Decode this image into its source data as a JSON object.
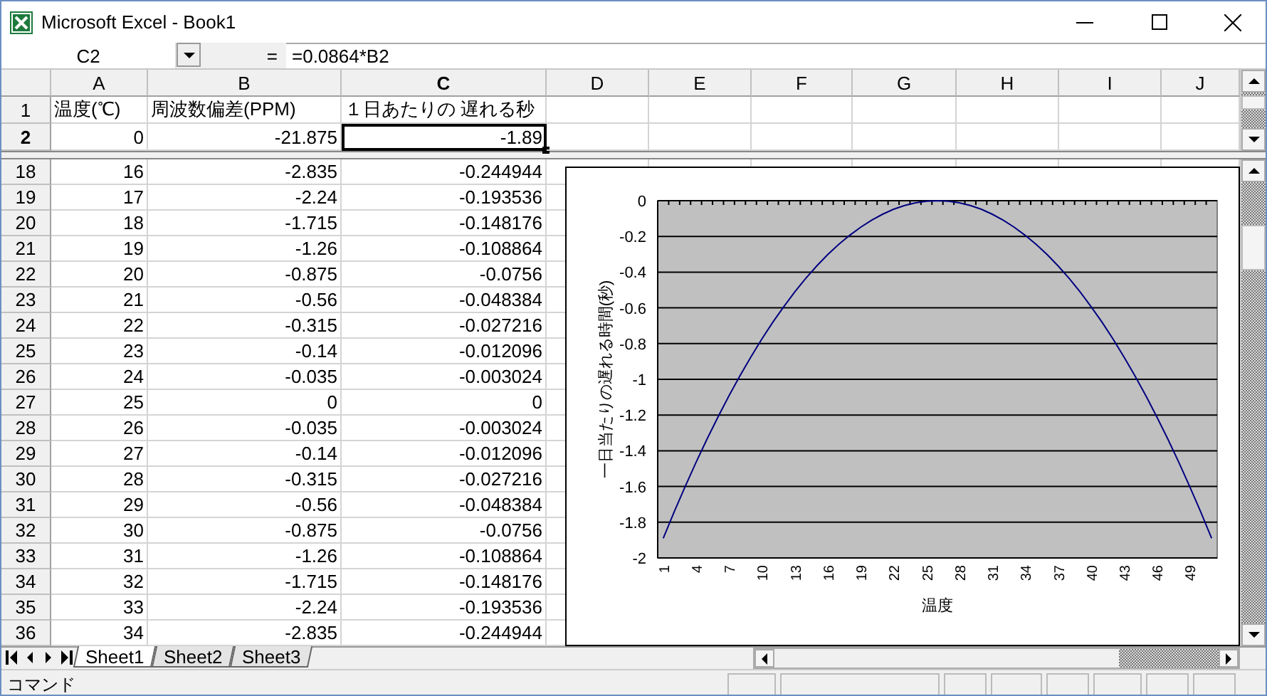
{
  "window": {
    "title": "Microsoft Excel - Book1"
  },
  "formula_bar": {
    "name_box": "C2",
    "equals": "=",
    "formula": "=0.0864*B2"
  },
  "columns": [
    {
      "label": "A",
      "selected": false
    },
    {
      "label": "B",
      "selected": false
    },
    {
      "label": "C",
      "selected": true
    },
    {
      "label": "D",
      "selected": false
    },
    {
      "label": "E",
      "selected": false
    },
    {
      "label": "F",
      "selected": false
    },
    {
      "label": "G",
      "selected": false
    },
    {
      "label": "H",
      "selected": false
    },
    {
      "label": "I",
      "selected": false
    },
    {
      "label": "J",
      "selected": false
    }
  ],
  "frozen_rows": [
    {
      "header": "1",
      "kind": "text",
      "selected": false,
      "cells": [
        "温度(℃)",
        "周波数偏差(PPM)",
        "１日あたりの 遅れる秒"
      ]
    },
    {
      "header": "2",
      "kind": "number",
      "selected": true,
      "cells": [
        "0",
        "-21.875",
        "-1.89"
      ]
    }
  ],
  "rows": [
    {
      "header": "18",
      "kind": "number",
      "selected": false,
      "cells": [
        "16",
        "-2.835",
        "-0.244944"
      ]
    },
    {
      "header": "19",
      "kind": "number",
      "selected": false,
      "cells": [
        "17",
        "-2.24",
        "-0.193536"
      ]
    },
    {
      "header": "20",
      "kind": "number",
      "selected": false,
      "cells": [
        "18",
        "-1.715",
        "-0.148176"
      ]
    },
    {
      "header": "21",
      "kind": "number",
      "selected": false,
      "cells": [
        "19",
        "-1.26",
        "-0.108864"
      ]
    },
    {
      "header": "22",
      "kind": "number",
      "selected": false,
      "cells": [
        "20",
        "-0.875",
        "-0.0756"
      ]
    },
    {
      "header": "23",
      "kind": "number",
      "selected": false,
      "cells": [
        "21",
        "-0.56",
        "-0.048384"
      ]
    },
    {
      "header": "24",
      "kind": "number",
      "selected": false,
      "cells": [
        "22",
        "-0.315",
        "-0.027216"
      ]
    },
    {
      "header": "25",
      "kind": "number",
      "selected": false,
      "cells": [
        "23",
        "-0.14",
        "-0.012096"
      ]
    },
    {
      "header": "26",
      "kind": "number",
      "selected": false,
      "cells": [
        "24",
        "-0.035",
        "-0.003024"
      ]
    },
    {
      "header": "27",
      "kind": "number",
      "selected": false,
      "cells": [
        "25",
        "0",
        "0"
      ]
    },
    {
      "header": "28",
      "kind": "number",
      "selected": false,
      "cells": [
        "26",
        "-0.035",
        "-0.003024"
      ]
    },
    {
      "header": "29",
      "kind": "number",
      "selected": false,
      "cells": [
        "27",
        "-0.14",
        "-0.012096"
      ]
    },
    {
      "header": "30",
      "kind": "number",
      "selected": false,
      "cells": [
        "28",
        "-0.315",
        "-0.027216"
      ]
    },
    {
      "header": "31",
      "kind": "number",
      "selected": false,
      "cells": [
        "29",
        "-0.56",
        "-0.048384"
      ]
    },
    {
      "header": "32",
      "kind": "number",
      "selected": false,
      "cells": [
        "30",
        "-0.875",
        "-0.0756"
      ]
    },
    {
      "header": "33",
      "kind": "number",
      "selected": false,
      "cells": [
        "31",
        "-1.26",
        "-0.108864"
      ]
    },
    {
      "header": "34",
      "kind": "number",
      "selected": false,
      "cells": [
        "32",
        "-1.715",
        "-0.148176"
      ]
    },
    {
      "header": "35",
      "kind": "number",
      "selected": false,
      "cells": [
        "33",
        "-2.24",
        "-0.193536"
      ]
    },
    {
      "header": "36",
      "kind": "number",
      "selected": false,
      "cells": [
        "34",
        "-2.835",
        "-0.244944"
      ]
    }
  ],
  "chart": {
    "chart_data": {
      "type": "line",
      "xlabel": "温度",
      "ylabel": "一日当たりの遅れる時間(秒)",
      "grid": true,
      "x": [
        1,
        2,
        3,
        4,
        5,
        6,
        7,
        8,
        9,
        10,
        11,
        12,
        13,
        14,
        15,
        16,
        17,
        18,
        19,
        20,
        21,
        22,
        23,
        24,
        25,
        26,
        27,
        28,
        29,
        30,
        31,
        32,
        33,
        34,
        35,
        36,
        37,
        38,
        39,
        40,
        41,
        42,
        43,
        44,
        45,
        46,
        47,
        48,
        49,
        50,
        51
      ],
      "xlim": [
        0.5,
        51.5
      ],
      "xticks": [
        1,
        4,
        7,
        10,
        13,
        16,
        19,
        22,
        25,
        28,
        31,
        34,
        37,
        40,
        43,
        46,
        49
      ],
      "ylim": [
        -2,
        0
      ],
      "yticks": [
        0,
        -0.2,
        -0.4,
        -0.6,
        -0.8,
        {
          "value": -1,
          "label": "-1"
        },
        -1.2,
        -1.4,
        -1.6,
        -1.8,
        {
          "value": -2,
          "label": "-2"
        }
      ],
      "series": [
        {
          "color": "#000080",
          "values": [
            -1.89,
            -1.742,
            -1.6,
            -1.464,
            -1.334,
            -1.21,
            -1.092,
            -0.98,
            -0.874,
            -0.774,
            -0.68,
            -0.593,
            -0.511,
            -0.435,
            -0.366,
            -0.302,
            -0.245,
            -0.194,
            -0.148,
            -0.109,
            -0.076,
            -0.048,
            -0.027,
            -0.012,
            -0.003,
            0,
            -0.003,
            -0.012,
            -0.027,
            -0.048,
            -0.076,
            -0.109,
            -0.148,
            -0.194,
            -0.245,
            -0.302,
            -0.366,
            -0.435,
            -0.511,
            -0.593,
            -0.68,
            -0.774,
            -0.874,
            -0.98,
            -1.092,
            -1.21,
            -1.334,
            -1.464,
            -1.6,
            -1.742,
            -1.89
          ]
        }
      ]
    }
  },
  "sheet_tabs": [
    {
      "label": "Sheet1",
      "selected": true
    },
    {
      "label": "Sheet2",
      "selected": false
    },
    {
      "label": "Sheet3",
      "selected": false
    }
  ],
  "status_bar": {
    "text": "コマンド"
  }
}
